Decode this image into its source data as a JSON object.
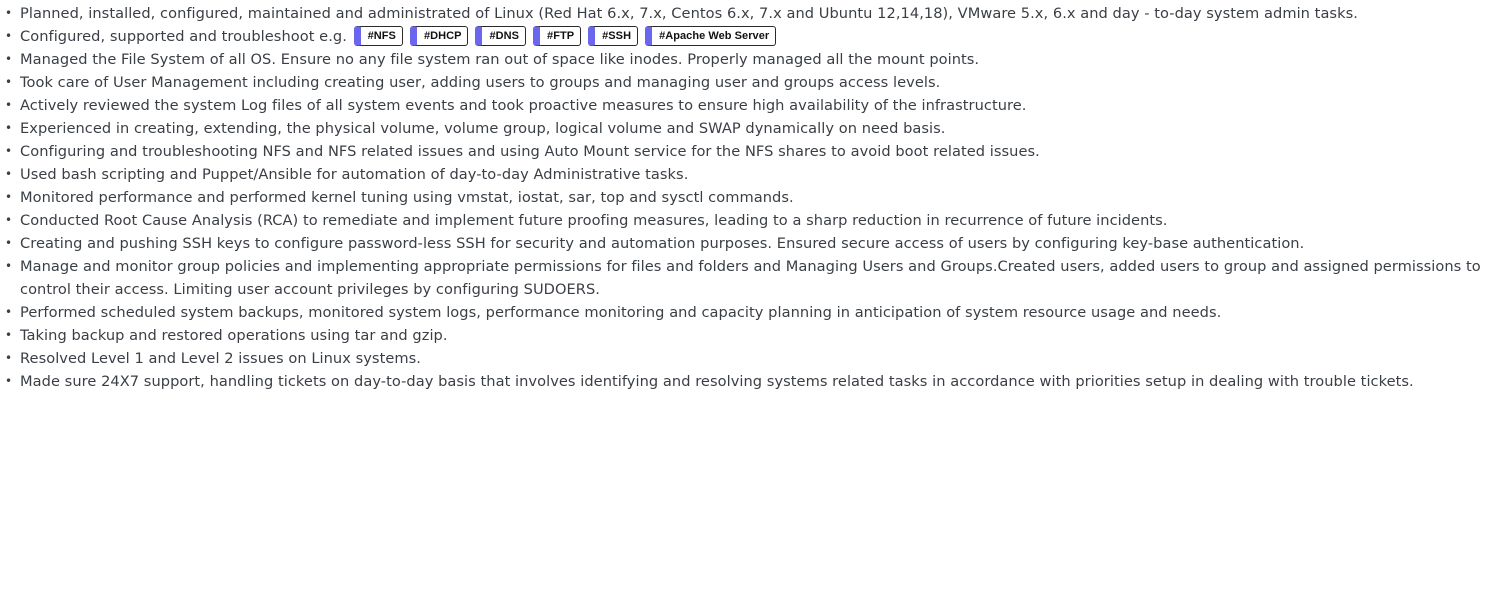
{
  "colors": {
    "text": "#3a3f45",
    "tag_accent": "#6b66ee",
    "tag_border": "#2a2a2a"
  },
  "items": [
    "Planned, installed, configured, maintained and administrated of Linux (Red Hat 6.x, 7.x, Centos 6.x, 7.x and Ubuntu 12,14,18), VMware 5.x, 6.x and day - to-day system admin tasks.",
    "Configured, supported and troubleshoot e.g.",
    "Managed the File System of all OS. Ensure no any file system ran out of space like inodes. Properly managed all the mount points.",
    "Took care of User Management including creating user, adding users to groups and managing user and groups access levels.",
    "Actively reviewed the system Log files of all system events and took proactive measures to ensure high availability of the infrastructure.",
    "Experienced in creating, extending, the physical volume, volume group, logical volume and SWAP dynamically on need basis.",
    "Configuring and troubleshooting NFS and NFS related issues and using Auto Mount service for the NFS shares to avoid boot related issues.",
    "Used bash scripting and Puppet/Ansible for automation of day-to-day Administrative tasks.",
    "Monitored performance and performed kernel tuning using vmstat, iostat, sar, top and sysctl commands.",
    "Conducted Root Cause Analysis (RCA) to remediate and implement future proofing measures, leading to a sharp reduction in recurrence of future incidents.",
    "Creating and pushing SSH keys to configure password-less SSH for security and automation purposes. Ensured secure access of users by configuring key-base authentication.",
    "Manage and monitor group policies and implementing appropriate permissions for files and folders and Managing Users and Groups.Created users, added users to group and assigned permissions to control their access. Limiting user account privileges by configuring SUDOERS.",
    "Performed scheduled system backups, monitored system logs, performance monitoring and capacity planning in anticipation of system resource usage and needs.",
    "Taking backup and restored operations using tar and gzip.",
    "Resolved Level 1 and Level 2 issues on Linux systems.",
    "Made sure 24X7 support, handling tickets on day-to-day basis that involves identifying and resolving systems related tasks in accordance with priorities setup in dealing with trouble tickets."
  ],
  "tags": [
    "#NFS",
    "#DHCP",
    "#DNS",
    "#FTP",
    "#SSH",
    "#Apache Web Server"
  ],
  "bullet_glyph": "•"
}
